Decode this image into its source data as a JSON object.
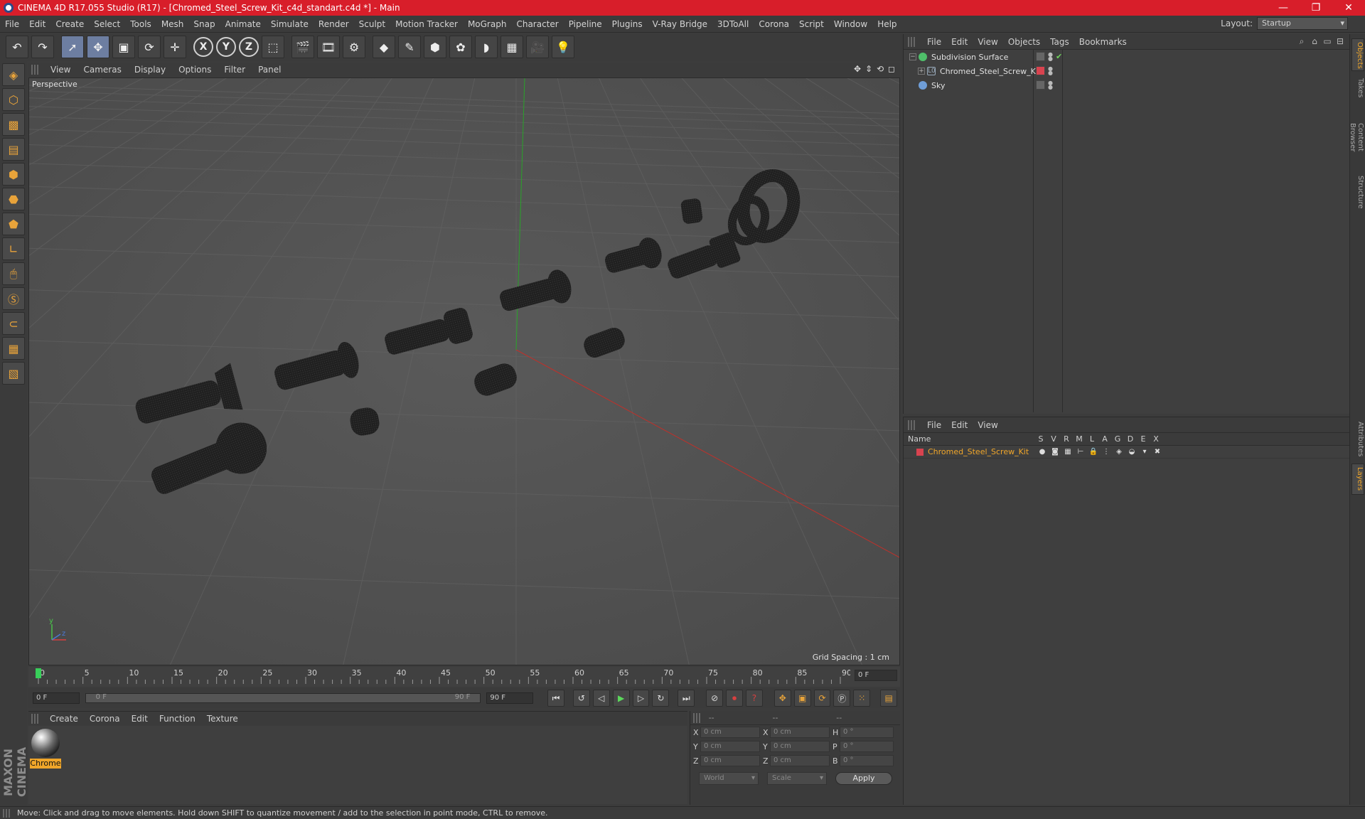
{
  "window": {
    "title": "CINEMA 4D R17.055 Studio (R17) - [Chromed_Steel_Screw_Kit_c4d_standart.c4d *] - Main",
    "minimize": "—",
    "restore": "❐",
    "close": "✕"
  },
  "menubar": {
    "items": [
      "File",
      "Edit",
      "Create",
      "Select",
      "Tools",
      "Mesh",
      "Snap",
      "Animate",
      "Simulate",
      "Render",
      "Sculpt",
      "Motion Tracker",
      "MoGraph",
      "Character",
      "Pipeline",
      "Plugins",
      "V-Ray Bridge",
      "3DToAll",
      "Corona",
      "Script",
      "Window",
      "Help"
    ],
    "layout_label": "Layout:",
    "layout_value": "Startup"
  },
  "toolbar": {
    "x_axis": "X",
    "y_axis": "Y",
    "z_axis": "Z"
  },
  "viewport": {
    "menu": [
      "View",
      "Cameras",
      "Display",
      "Options",
      "Filter",
      "Panel"
    ],
    "label": "Perspective",
    "grid_spacing": "Grid Spacing : 1 cm",
    "axis_x_color": "#c0302a",
    "axis_y_color": "#29a329"
  },
  "timeline": {
    "ticks": [
      "0",
      "5",
      "10",
      "15",
      "20",
      "25",
      "30",
      "35",
      "40",
      "45",
      "50",
      "55",
      "60",
      "65",
      "70",
      "75",
      "80",
      "85",
      "90"
    ],
    "current_frame": "0 F",
    "start_field": "0 F",
    "range_start": "0 F",
    "range_end": "90 F",
    "end_field": "90 F"
  },
  "material_manager": {
    "menu": [
      "Create",
      "Corona",
      "Edit",
      "Function",
      "Texture"
    ],
    "material_name": "Chrome"
  },
  "coordinates": {
    "headers": [
      "--",
      "--",
      "--"
    ],
    "rows": [
      {
        "a1": "X",
        "v1": "0 cm",
        "a2": "X",
        "v2": "0 cm",
        "a3": "H",
        "v3": "0 °"
      },
      {
        "a1": "Y",
        "v1": "0 cm",
        "a2": "Y",
        "v2": "0 cm",
        "a3": "P",
        "v3": "0 °"
      },
      {
        "a1": "Z",
        "v1": "0 cm",
        "a2": "Z",
        "v2": "0 cm",
        "a3": "B",
        "v3": "0 °"
      }
    ],
    "coord_system": "World",
    "mode": "Scale",
    "apply": "Apply"
  },
  "object_manager": {
    "menu": [
      "File",
      "Edit",
      "View",
      "Objects",
      "Tags",
      "Bookmarks"
    ],
    "objects": [
      {
        "name": "Subdivision Surface",
        "color": "#4fbf6a"
      },
      {
        "name": "Chromed_Steel_Screw_Kit",
        "color": "#d8434f"
      },
      {
        "name": "Sky",
        "color": "#6f9ed8"
      }
    ]
  },
  "layer_manager": {
    "menu": [
      "File",
      "Edit",
      "View"
    ],
    "name_header": "Name",
    "columns": [
      "S",
      "V",
      "R",
      "M",
      "L",
      "A",
      "G",
      "D",
      "E",
      "X"
    ],
    "layer_name": "Chromed_Steel_Screw_Kit",
    "layer_color": "#d8434f"
  },
  "side_tabs": [
    "Objects",
    "Takes",
    "Content Browser",
    "Structure",
    "Attributes",
    "Layers"
  ],
  "status": {
    "text": "Move: Click and drag to move elements. Hold down SHIFT to quantize movement / add to the selection in point mode, CTRL to remove."
  }
}
